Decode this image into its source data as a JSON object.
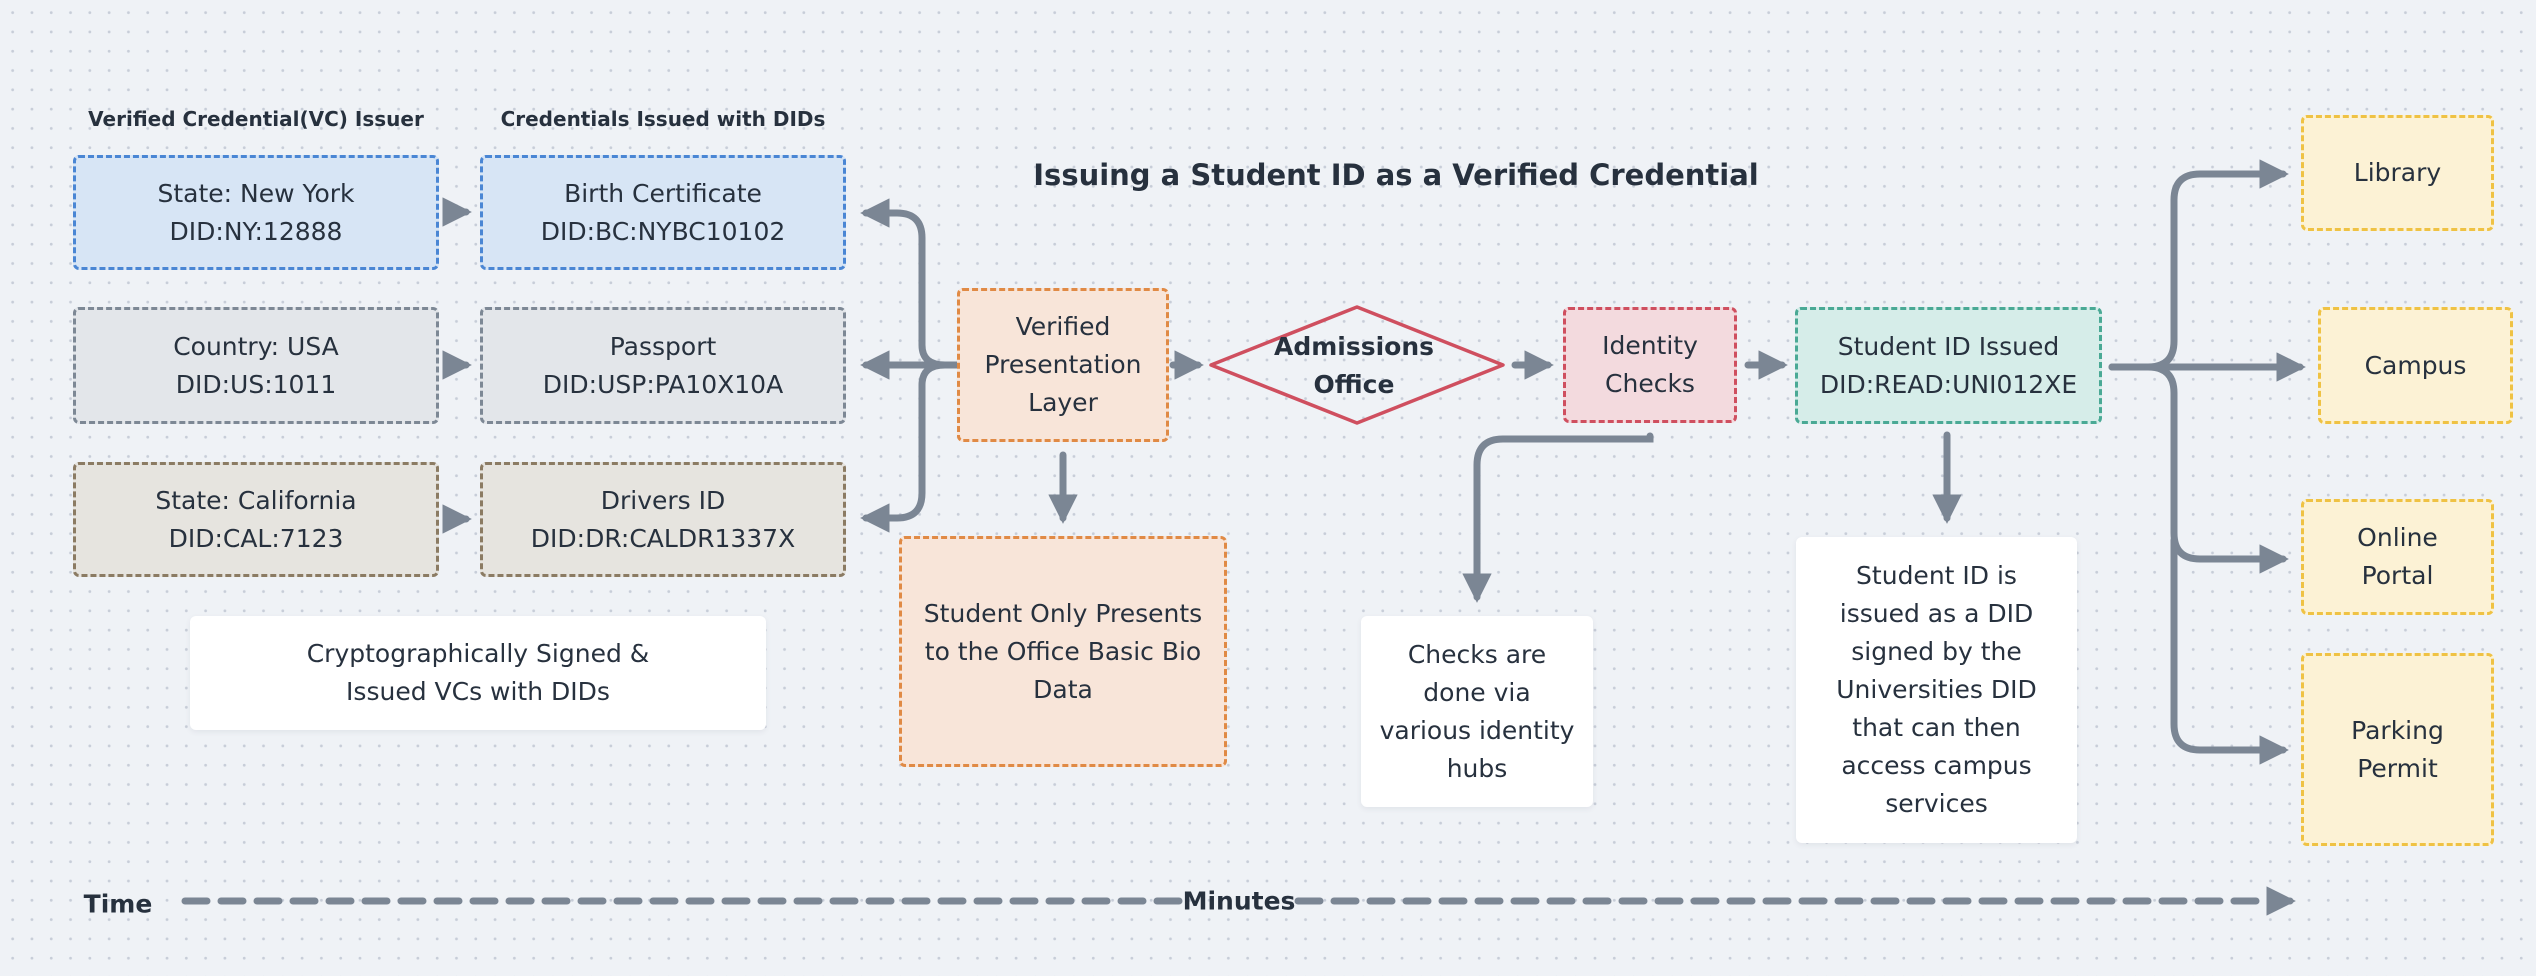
{
  "title": "Issuing a Student ID as a Verified Credential",
  "column_headers": {
    "issuer": "Verified Credential(VC) Issuer",
    "credentials": "Credentials Issued with DIDs"
  },
  "issuers": [
    {
      "name": "State: New York",
      "did": "DID:NY:12888",
      "color": "#4a86d4"
    },
    {
      "name": "Country: USA",
      "did": "DID:US:1011",
      "color": "#7d8895"
    },
    {
      "name": "State: California",
      "did": "DID:CAL:7123",
      "color": "#8b7b63"
    }
  ],
  "credentials": [
    {
      "name": "Birth Certificate",
      "did": "DID:BC:NYBC10102"
    },
    {
      "name": "Passport",
      "did": "DID:USP:PA10X10A"
    },
    {
      "name": "Drivers ID",
      "did": "DID:DR:CALDR1337X"
    }
  ],
  "flow": {
    "presentation_layer": "Verified\nPresentation\nLayer",
    "admissions_office": "Admissions\nOffice",
    "identity_checks": "Identity\nChecks",
    "student_id_issued": {
      "name": "Student ID Issued",
      "did": "DID:READ:UNI012XE"
    }
  },
  "services": [
    "Library",
    "Campus",
    "Online\nPortal",
    "Parking\nPermit"
  ],
  "notes": {
    "crypto": "Cryptographically Signed &\nIssued VCs with DIDs",
    "bio_data": "Student Only Presents\nto the Office Basic Bio\nData",
    "identity_hubs": "Checks are\ndone via\nvarious identity\nhubs",
    "student_id_info": "Student ID is\nissued as a DID\nsigned by the\nUniversities DID\nthat can then\naccess campus\nservices"
  },
  "timeline": {
    "label": "Time",
    "unit": "Minutes"
  },
  "colors": {
    "connector": "#7b8694",
    "diamond": "#cf4f5f",
    "text": "#27313e"
  }
}
